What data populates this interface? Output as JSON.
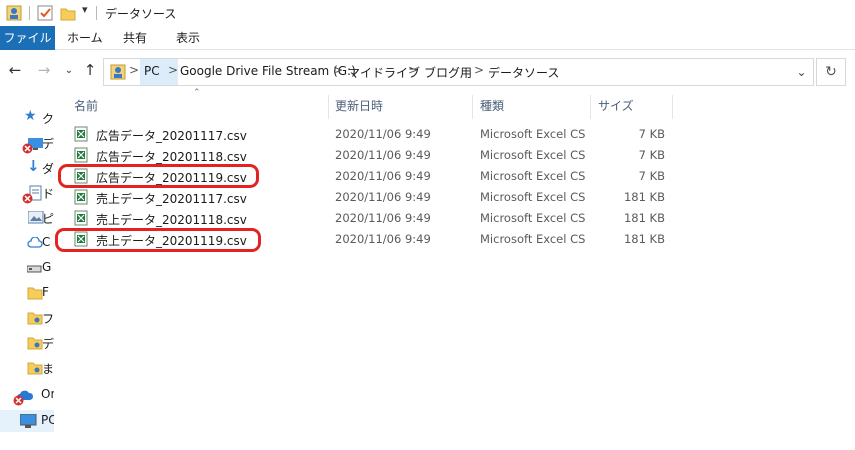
{
  "window": {
    "title": "データソース",
    "quick_access_dropdown": "▾"
  },
  "ribbon": {
    "tabs": [
      "ファイル",
      "ホーム",
      "共有",
      "表示"
    ]
  },
  "address_bar": {
    "crumbs": [
      "PC",
      "Google Drive File Stream (G:)",
      "マイドライブ",
      "ブログ用",
      "データソース"
    ],
    "separator": ">"
  },
  "nav_pane": {
    "items": [
      {
        "label": "ク",
        "icon": "star-icon"
      },
      {
        "label": "デ",
        "icon": "desktop-icon"
      },
      {
        "label": "ダ",
        "icon": "download-icon"
      },
      {
        "label": "ド",
        "icon": "document-icon"
      },
      {
        "label": "ピ",
        "icon": "picture-icon"
      },
      {
        "label": "C",
        "icon": "cloud-icon"
      },
      {
        "label": "G",
        "icon": "drive-icon"
      },
      {
        "label": "F",
        "icon": "folder-icon"
      },
      {
        "label": "フ",
        "icon": "folder-icon"
      },
      {
        "label": "デ",
        "icon": "folder-icon"
      },
      {
        "label": "ま",
        "icon": "folder-icon"
      },
      {
        "label": "On",
        "icon": "onedrive-icon"
      },
      {
        "label": "PC",
        "icon": "pc-icon"
      }
    ]
  },
  "columns": {
    "name": "名前",
    "date": "更新日時",
    "type": "種類",
    "size": "サイズ"
  },
  "files": [
    {
      "name": "広告データ_20201117.csv",
      "date": "2020/11/06 9:49",
      "type": "Microsoft Excel CS...",
      "size": "7 KB",
      "highlighted": false
    },
    {
      "name": "広告データ_20201118.csv",
      "date": "2020/11/06 9:49",
      "type": "Microsoft Excel CS...",
      "size": "7 KB",
      "highlighted": false
    },
    {
      "name": "広告データ_20201119.csv",
      "date": "2020/11/06 9:49",
      "type": "Microsoft Excel CS...",
      "size": "7 KB",
      "highlighted": true
    },
    {
      "name": "売上データ_20201117.csv",
      "date": "2020/11/06 9:49",
      "type": "Microsoft Excel CS...",
      "size": "181 KB",
      "highlighted": false
    },
    {
      "name": "売上データ_20201118.csv",
      "date": "2020/11/06 9:49",
      "type": "Microsoft Excel CS...",
      "size": "181 KB",
      "highlighted": false
    },
    {
      "name": "売上データ_20201119.csv",
      "date": "2020/11/06 9:49",
      "type": "Microsoft Excel CS...",
      "size": "181 KB",
      "highlighted": true
    }
  ],
  "colors": {
    "file_tab": "#1a6fb7",
    "highlight": "#e52222",
    "selected_segment": "#dcecfb",
    "header_text": "#4c607a"
  }
}
